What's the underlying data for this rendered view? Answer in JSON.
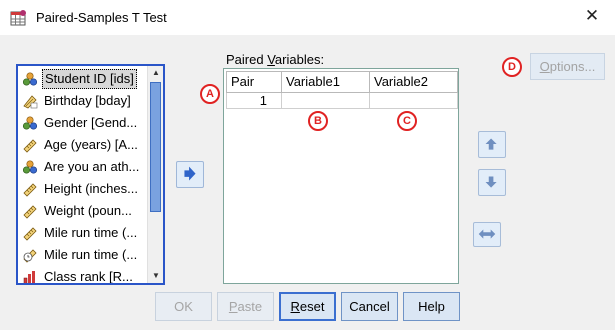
{
  "window": {
    "title": "Paired-Samples T Test",
    "close_glyph": "✕",
    "icon": "spss-grid-icon"
  },
  "variables": [
    {
      "label": "Student ID [ids]",
      "icon": "nominal-icon",
      "selected": true
    },
    {
      "label": "Birthday [bday]",
      "icon": "date-icon"
    },
    {
      "label": "Gender [Gend...",
      "icon": "nominal-icon"
    },
    {
      "label": "Age (years) [A...",
      "icon": "scale-ruler-icon"
    },
    {
      "label": "Are you an ath...",
      "icon": "nominal-icon"
    },
    {
      "label": "Height (inches...",
      "icon": "scale-ruler-icon"
    },
    {
      "label": "Weight (poun...",
      "icon": "scale-ruler-icon"
    },
    {
      "label": "Mile run time (...",
      "icon": "scale-ruler-icon"
    },
    {
      "label": "Mile run time (...",
      "icon": "time-icon"
    },
    {
      "label": "Class rank [R...",
      "icon": "ordinal-bar-icon"
    }
  ],
  "paired": {
    "label_prefix": "Paired ",
    "label_underlined": "V",
    "label_suffix": "ariables:",
    "columns": [
      "Pair",
      "Variable1",
      "Variable2"
    ],
    "rows": [
      {
        "pair": "1",
        "var1": "",
        "var2": ""
      }
    ]
  },
  "options": {
    "label_prefix": "",
    "label_underlined": "O",
    "label_suffix": "ptions..."
  },
  "badges": {
    "a": "A",
    "b": "B",
    "c": "C",
    "d": "D"
  },
  "buttons": {
    "ok": "OK",
    "paste_u": "P",
    "paste_rest": "aste",
    "reset_u": "R",
    "reset_rest": "eset",
    "cancel": "Cancel",
    "help": "Help"
  },
  "colors": {
    "list_border": "#2a55c8",
    "badge_red": "#e02222",
    "arrow_blue": "#2f64c9"
  }
}
